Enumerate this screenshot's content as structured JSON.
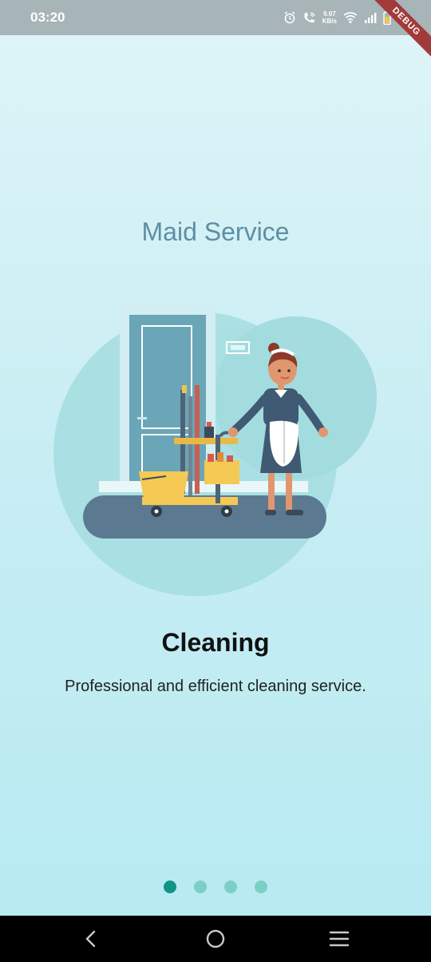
{
  "status_bar": {
    "time": "03:20",
    "net_speed_value": "9.07",
    "net_speed_unit": "KB/s",
    "icons": [
      "alarm-icon",
      "wifi-calling-icon",
      "wifi-icon",
      "signal-icon",
      "battery-icon"
    ]
  },
  "debug_banner": "DEBUG",
  "page": {
    "title": "Maid Service"
  },
  "slide": {
    "title": "Cleaning",
    "description": "Professional and efficient cleaning service.",
    "illustration": "maid-cleaning-illustration"
  },
  "pager": {
    "count": 4,
    "active_index": 0
  },
  "nav_bar": {
    "buttons": [
      "back-icon",
      "home-icon",
      "menu-icon"
    ]
  },
  "colors": {
    "title": "#5e8fa3",
    "dot_active": "#0f9486",
    "dot_inactive": "#7ccfc5",
    "status_bar": "#a7b4b8"
  }
}
